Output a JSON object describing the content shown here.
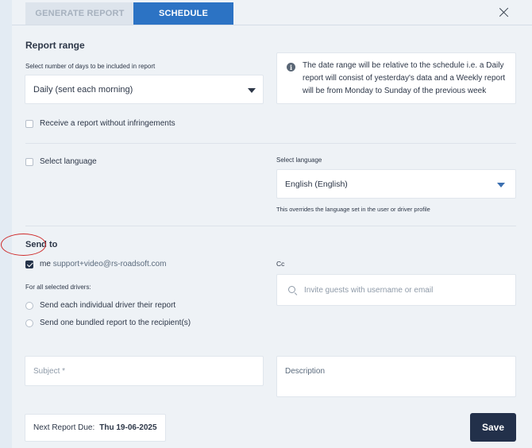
{
  "tabs": [
    {
      "label": "GENERATE REPORT"
    },
    {
      "label": "SCHEDULE"
    }
  ],
  "report_range": {
    "title": "Report range",
    "days_label": "Select number of days to be included in report",
    "days_value": "Daily (sent each morning)",
    "info_text": "The date range will be relative to the schedule i.e. a Daily report will consist of yesterday's data and a Weekly report will be from Monday to Sunday of the previous week",
    "no_infringements_label": "Receive a report without infringements"
  },
  "language": {
    "checkbox_label": "Select language",
    "field_label": "Select language",
    "value": "English (English)",
    "note": "This overrides the language set in the user or driver profile"
  },
  "send_to": {
    "title": "Send to",
    "me_label": "me",
    "me_email": "support+video@rs-roadsoft.com",
    "drivers_label": "For all selected drivers:",
    "option_individual": "Send each individual driver their report",
    "option_bundled": "Send one bundled report to the recipient(s)",
    "cc_label": "Cc",
    "cc_placeholder": "Invite guests with username or email"
  },
  "email": {
    "subject_placeholder": "Subject *",
    "description_placeholder": "Description"
  },
  "footer": {
    "next_due_label": "Next Report Due:",
    "next_due_value": "Thu 19-06-2025",
    "save_label": "Save"
  },
  "colors": {
    "accent": "#2c73c4",
    "save": "#22304a",
    "annotation": "#cf2a2a"
  }
}
